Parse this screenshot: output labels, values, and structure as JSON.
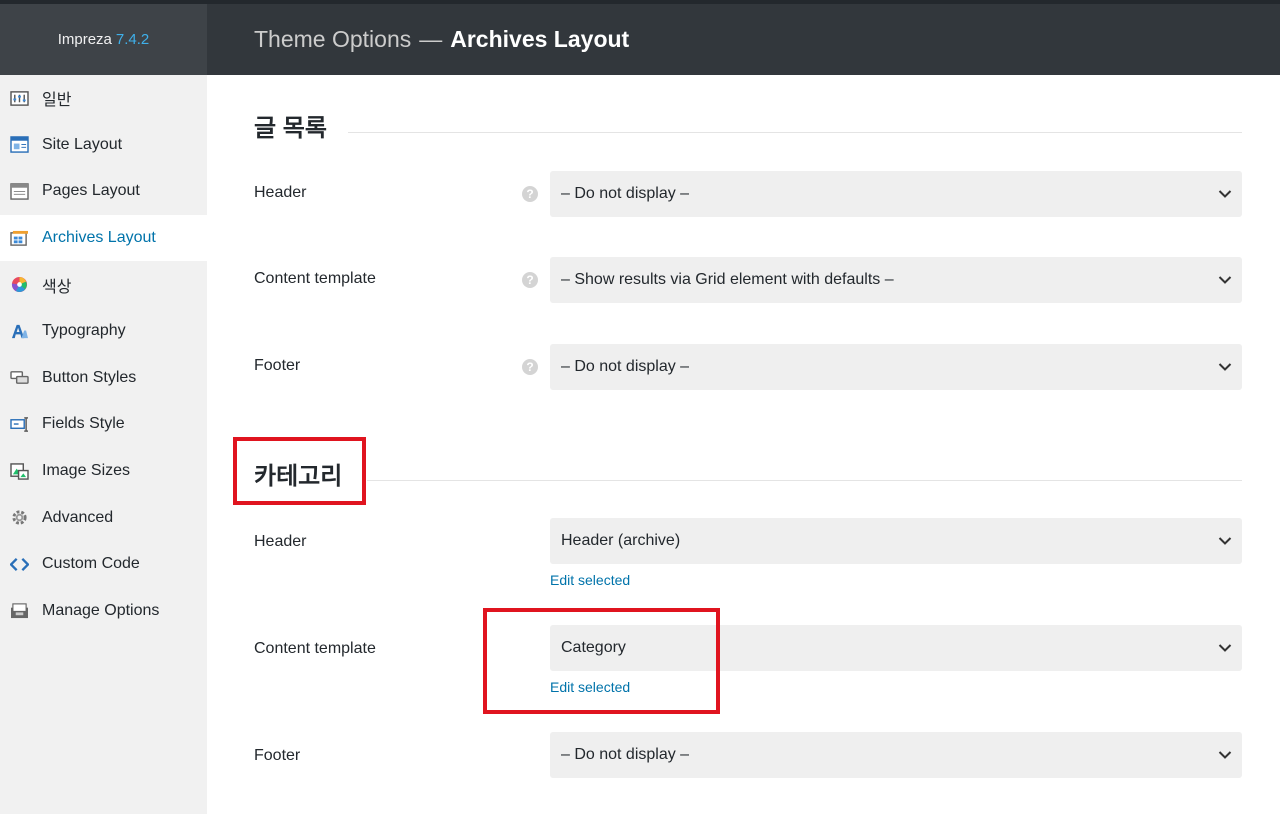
{
  "app": {
    "name": "Impreza",
    "version": "7.4.2"
  },
  "header": {
    "prefix": "Theme Options",
    "separator": "—",
    "current": "Archives Layout"
  },
  "sidebar": {
    "items": [
      {
        "label": "일반",
        "icon": "sliders-icon",
        "active": false
      },
      {
        "label": "Site Layout",
        "icon": "site-layout-icon",
        "active": false
      },
      {
        "label": "Pages Layout",
        "icon": "pages-layout-icon",
        "active": false
      },
      {
        "label": "Archives Layout",
        "icon": "archives-layout-icon",
        "active": true
      },
      {
        "label": "색상",
        "icon": "color-wheel-icon",
        "active": false
      },
      {
        "label": "Typography",
        "icon": "typography-icon",
        "active": false
      },
      {
        "label": "Button Styles",
        "icon": "button-styles-icon",
        "active": false
      },
      {
        "label": "Fields Style",
        "icon": "fields-style-icon",
        "active": false
      },
      {
        "label": "Image Sizes",
        "icon": "image-sizes-icon",
        "active": false
      },
      {
        "label": "Advanced",
        "icon": "gear-icon",
        "active": false
      },
      {
        "label": "Custom Code",
        "icon": "code-icon",
        "active": false
      },
      {
        "label": "Manage Options",
        "icon": "manage-options-icon",
        "active": false
      }
    ]
  },
  "sections": [
    {
      "title": "글 목록",
      "rows": [
        {
          "label": "Header",
          "help": "?",
          "value": "– Do not display –"
        },
        {
          "label": "Content template",
          "help": "?",
          "value": "– Show results via Grid element with defaults –"
        },
        {
          "label": "Footer",
          "help": "?",
          "value": "– Do not display –"
        }
      ]
    },
    {
      "title": "카테고리",
      "rows": [
        {
          "label": "Header",
          "value": "Header (archive)",
          "link": "Edit selected"
        },
        {
          "label": "Content template",
          "value": "Category",
          "link": "Edit selected"
        },
        {
          "label": "Footer",
          "value": "– Do not display –"
        }
      ]
    }
  ],
  "colors": {
    "accent": "#0073aa",
    "highlight": "#e0141f",
    "topbar": "#32373c",
    "version": "#3fb0ea"
  }
}
